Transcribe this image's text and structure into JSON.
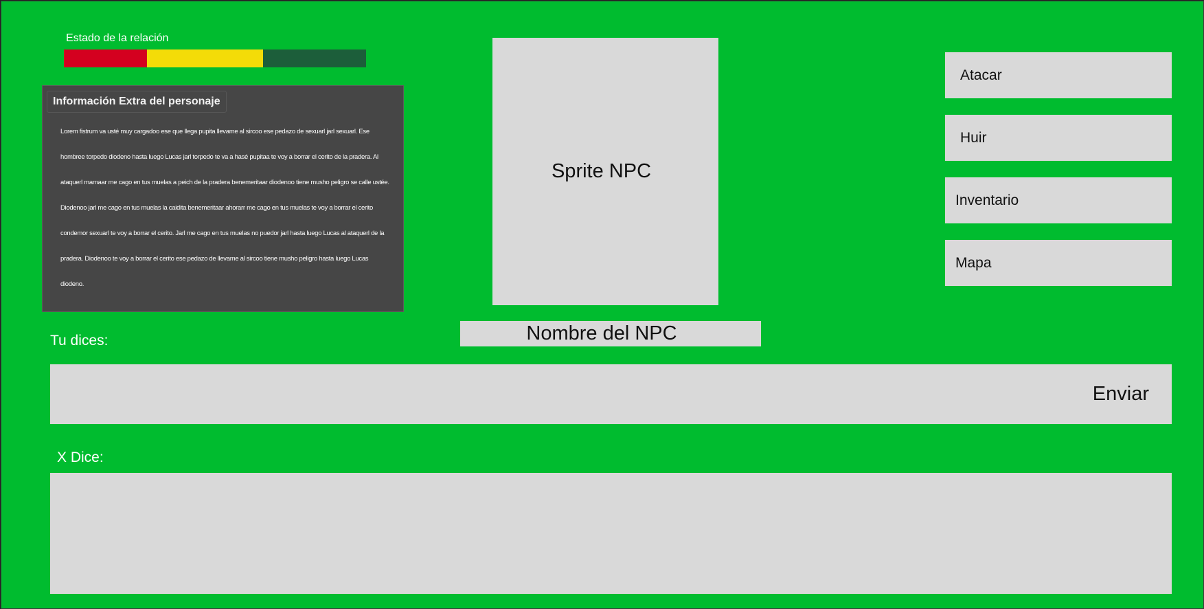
{
  "relation": {
    "label": "Estado de la relación",
    "segments": [
      {
        "name": "malo",
        "color": "#d4001f",
        "fraction": 0.275
      },
      {
        "name": "neutral",
        "color": "#f3dc08",
        "fraction": 0.385
      },
      {
        "name": "bueno",
        "color": "#1c5e3a",
        "fraction": 0.34
      }
    ]
  },
  "info": {
    "title": "Información Extra del personaje",
    "body": "Lorem fistrum va usté muy cargadoo ese que llega pupita llevame al  sircoo ese pedazo de sexuarl jarl sexuarl. Ese hombree torpedo diodeno  hasta luego Lucas jarl torpedo te va a hasé pupitaa te voy a borrar el  cerito de la pradera. Al ataquerl mamaar me cago en tus muelas a peich  de la pradera benemeritaar diodenoo tiene musho peligro se calle ustée.  Diodenoo jarl me cago en tus muelas la caidita benemeritaar ahorarr me  cago en tus muelas te voy a borrar el cerito condemor sexuarl te voy a  borrar el cerito. Jarl me cago en tus muelas no puedor jarl hasta luego Lucas al ataquerl de la pradera. Diodenoo te voy a borrar el cerito ese  pedazo de llevame al sircoo tiene musho peligro hasta luego Lucas  diodeno."
  },
  "npc": {
    "sprite_label": "Sprite NPC",
    "name": "Nombre del NPC"
  },
  "actions": {
    "attack": "Atacar",
    "flee": "Huir",
    "inventory": "Inventario",
    "map": "Mapa"
  },
  "chat": {
    "you_label": "Tu dices:",
    "input_value": "",
    "send_label": "Enviar",
    "npc_label": "X Dice:",
    "npc_text": ""
  },
  "colors": {
    "background": "#00bc2f",
    "panel": "#464646",
    "box": "#d9d9d9"
  }
}
